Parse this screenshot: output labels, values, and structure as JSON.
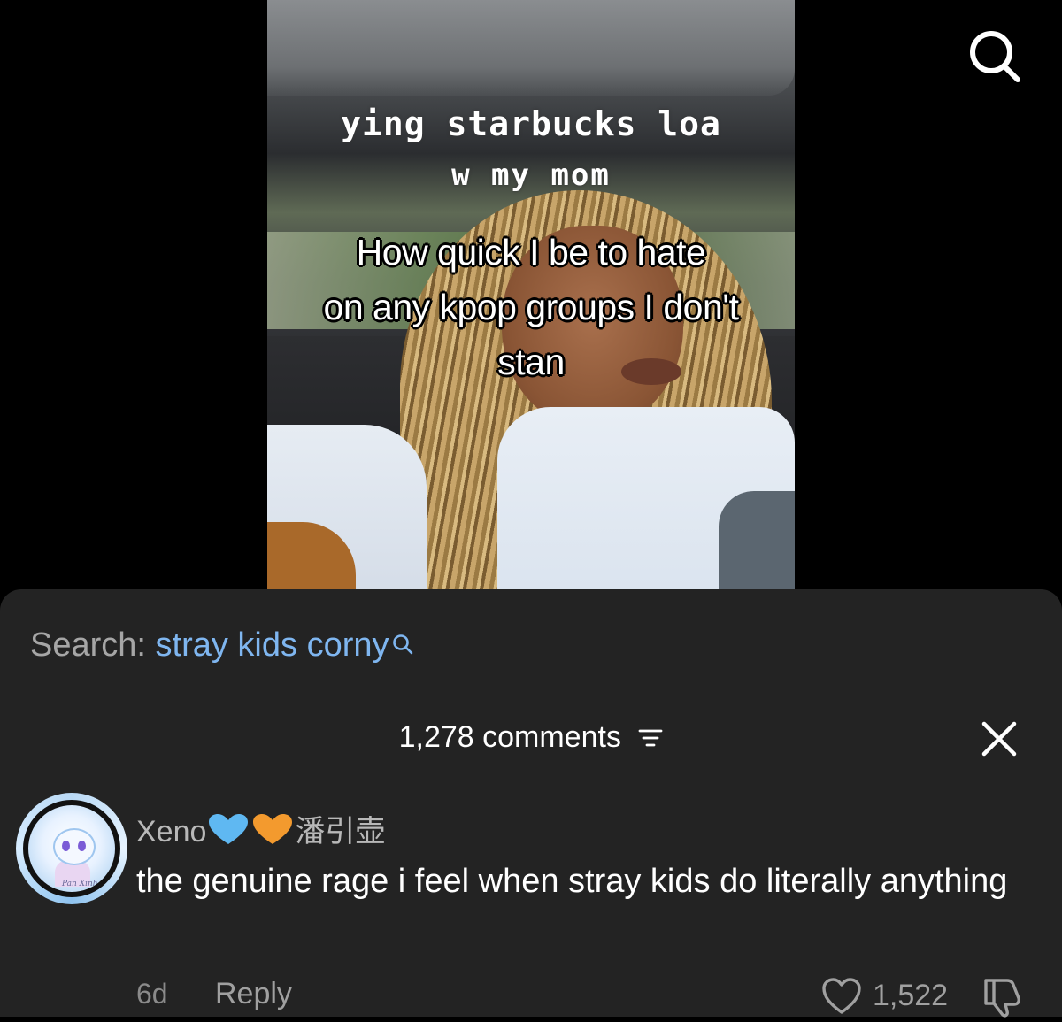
{
  "video": {
    "caption_line1": "ying starbucks loa",
    "caption_line2": "w my mom",
    "overlay_line1": "How quick I be to hate",
    "overlay_line2": "on any kpop groups I don't",
    "overlay_line3": "stan"
  },
  "search_icon": "search-icon",
  "search_suggestion": {
    "prefix": "Search:",
    "query": "stray kids corny"
  },
  "comments_header": {
    "count_label": "1,278 comments"
  },
  "comment": {
    "username": "Xeno",
    "username_suffix": "潘引壶",
    "text": "the genuine rage i feel when stray kids do literally anything",
    "time": "6d",
    "reply_label": "Reply",
    "like_count": "1,522",
    "avatar_signature": "Pan Xinh"
  },
  "colors": {
    "sheet_bg": "#232323",
    "search_query": "#7fb6f0",
    "heart_blue": "#5fb8f2",
    "heart_orange": "#f39a2e"
  }
}
